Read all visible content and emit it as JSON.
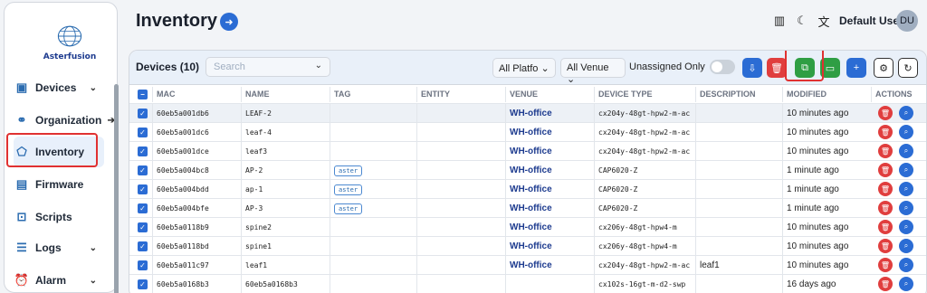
{
  "sidebar": {
    "logo_text": "Asterfusion",
    "items": [
      {
        "label": "Devices",
        "icon": "chip-icon",
        "suffix": "chevron"
      },
      {
        "label": "Organization",
        "icon": "network-icon",
        "suffix": "arrow"
      },
      {
        "label": "Inventory",
        "icon": "tag-icon",
        "suffix": ""
      },
      {
        "label": "Firmware",
        "icon": "save-icon",
        "suffix": ""
      },
      {
        "label": "Scripts",
        "icon": "terminal-icon",
        "suffix": ""
      },
      {
        "label": "Logs",
        "icon": "list-icon",
        "suffix": "chevron"
      },
      {
        "label": "Alarm",
        "icon": "alarm-icon",
        "suffix": "chevron"
      }
    ]
  },
  "header": {
    "title": "Inventory",
    "user_name": "Default User",
    "avatar_initials": "DU"
  },
  "card": {
    "title": "Devices (10)",
    "search_placeholder": "Search",
    "platform_select": "All Platfo",
    "venue_select": "All Venue",
    "toggle_label": "Unassigned Only",
    "toggle_on": false,
    "colors": {
      "blue": "#2b6cd4",
      "red": "#e03e3e",
      "green": "#2f9e44"
    }
  },
  "table": {
    "columns": [
      "MAC",
      "NAME",
      "TAG",
      "ENTITY",
      "VENUE",
      "DEVICE TYPE",
      "DESCRIPTION",
      "MODIFIED",
      "ACTIONS"
    ],
    "rows": [
      {
        "mac": "60eb5a001db6",
        "name": "LEAF-2",
        "tag": "",
        "entity": "",
        "venue": "WH-office",
        "type": "cx204y-48gt-hpw2-m-ac",
        "desc": "",
        "modified": "10 minutes ago"
      },
      {
        "mac": "60eb5a001dc6",
        "name": "leaf-4",
        "tag": "",
        "entity": "",
        "venue": "WH-office",
        "type": "cx204y-48gt-hpw2-m-ac",
        "desc": "",
        "modified": "10 minutes ago"
      },
      {
        "mac": "60eb5a001dce",
        "name": "leaf3",
        "tag": "",
        "entity": "",
        "venue": "WH-office",
        "type": "cx204y-48gt-hpw2-m-ac",
        "desc": "",
        "modified": "10 minutes ago"
      },
      {
        "mac": "60eb5a004bc8",
        "name": "AP-2",
        "tag": "aster",
        "entity": "",
        "venue": "WH-office",
        "type": "CAP6020-Z",
        "desc": "",
        "modified": "1 minute ago"
      },
      {
        "mac": "60eb5a004bdd",
        "name": "ap-1",
        "tag": "aster",
        "entity": "",
        "venue": "WH-office",
        "type": "CAP6020-Z",
        "desc": "",
        "modified": "1 minute ago"
      },
      {
        "mac": "60eb5a004bfe",
        "name": "AP-3",
        "tag": "aster",
        "entity": "",
        "venue": "WH-office",
        "type": "CAP6020-Z",
        "desc": "",
        "modified": "1 minute ago"
      },
      {
        "mac": "60eb5a0118b9",
        "name": "spine2",
        "tag": "",
        "entity": "",
        "venue": "WH-office",
        "type": "cx206y-48gt-hpw4-m",
        "desc": "",
        "modified": "10 minutes ago"
      },
      {
        "mac": "60eb5a0118bd",
        "name": "spine1",
        "tag": "",
        "entity": "",
        "venue": "WH-office",
        "type": "cx206y-48gt-hpw4-m",
        "desc": "",
        "modified": "10 minutes ago"
      },
      {
        "mac": "60eb5a011c97",
        "name": "leaf1",
        "tag": "",
        "entity": "",
        "venue": "WH-office",
        "type": "cx204y-48gt-hpw2-m-ac",
        "desc": "leaf1",
        "modified": "10 minutes ago"
      },
      {
        "mac": "60eb5a0168b3",
        "name": "60eb5a0168b3",
        "tag": "",
        "entity": "",
        "venue": "",
        "type": "cx102s-16gt-m-d2-swp",
        "desc": "",
        "modified": "16 days ago"
      }
    ]
  }
}
